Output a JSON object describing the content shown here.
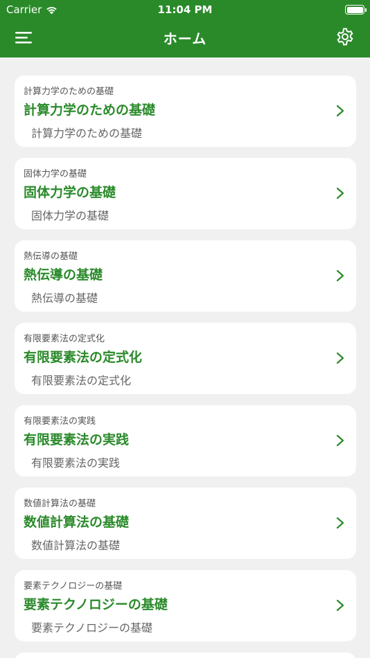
{
  "status_bar": {
    "carrier": "Carrier",
    "time": "11:04 PM"
  },
  "nav": {
    "title": "ホーム",
    "menu_icon": "hamburger-menu-icon",
    "settings_icon": "gear-icon"
  },
  "colors": {
    "accent": "#2a8a2a",
    "background": "#f0f0f0",
    "card": "#ffffff"
  },
  "items": [
    {
      "small": "計算力学のための基礎",
      "title": "計算力学のための基礎",
      "subtitle": "計算力学のための基礎"
    },
    {
      "small": "固体力学の基礎",
      "title": "固体力学の基礎",
      "subtitle": "固体力学の基礎"
    },
    {
      "small": "熱伝導の基礎",
      "title": "熱伝導の基礎",
      "subtitle": "熱伝導の基礎"
    },
    {
      "small": "有限要素法の定式化",
      "title": "有限要素法の定式化",
      "subtitle": "有限要素法の定式化"
    },
    {
      "small": "有限要素法の実践",
      "title": "有限要素法の実践",
      "subtitle": "有限要素法の実践"
    },
    {
      "small": "数値計算法の基礎",
      "title": "数値計算法の基礎",
      "subtitle": "数値計算法の基礎"
    },
    {
      "small": "要素テクノロジーの基礎",
      "title": "要素テクノロジーの基礎",
      "subtitle": "要素テクノロジーの基礎"
    }
  ]
}
